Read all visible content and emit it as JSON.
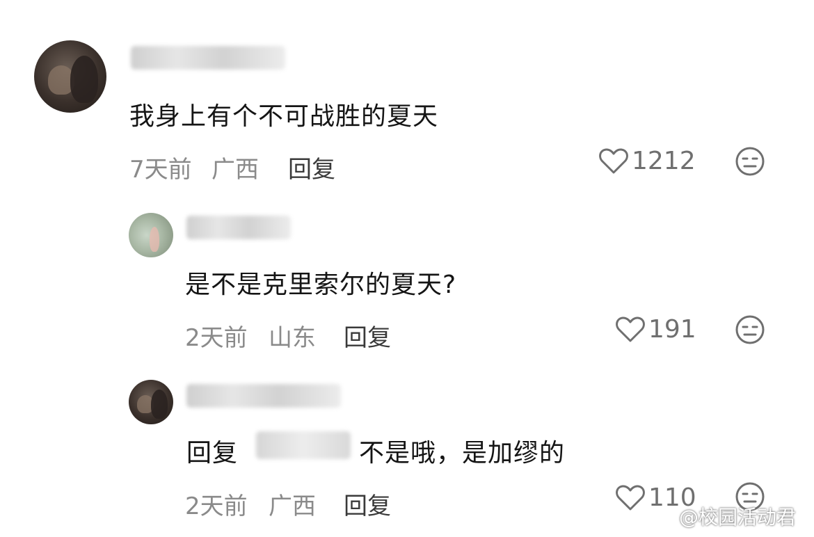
{
  "comments": [
    {
      "text": "我身上有个不可战胜的夏天",
      "time": "7天前",
      "location": "广西",
      "reply_label": "回复",
      "likes": "1212"
    },
    {
      "text": "是不是克里索尔的夏天?",
      "time": "2天前",
      "location": "山东",
      "reply_label": "回复",
      "likes": "191"
    },
    {
      "text_prefix": "回复",
      "text_suffix": "不是哦，是加缪的",
      "time": "2天前",
      "location": "广西",
      "reply_label": "回复",
      "likes": "110"
    }
  ],
  "watermark": {
    "text": "@校园活动君"
  },
  "icons": {
    "like": "heart-outline-icon",
    "emoji": "neutral-face-icon",
    "watermark": "weibo-logo-icon"
  },
  "colors": {
    "text": "#151515",
    "meta": "#8a8a8a",
    "icon": "#6f6f6f"
  }
}
